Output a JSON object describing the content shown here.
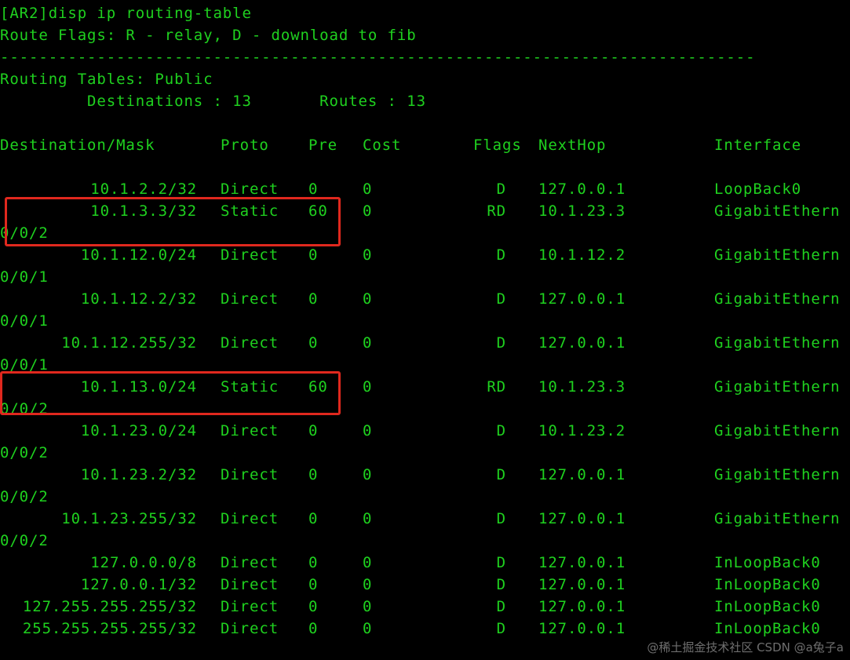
{
  "terminal": {
    "header_lines": [
      "[AR2]disp ip routing-table",
      "Route Flags: R - relay, D - download to fib",
      "------------------------------------------------------------------------------",
      "Routing Tables: Public",
      "         Destinations : 13       Routes : 13"
    ],
    "columns": {
      "destination": "Destination/Mask",
      "proto": "Proto",
      "pre": "Pre",
      "cost": "Cost",
      "flags": "Flags",
      "nexthop": "NextHop",
      "interface": "Interface"
    },
    "routes": [
      {
        "dest": "10.1.2.2/32",
        "proto": "Direct",
        "pre": "0",
        "cost": "0",
        "flags": "D",
        "nexthop": "127.0.0.1",
        "iface": "LoopBack0",
        "wrap": ""
      },
      {
        "dest": "10.1.3.3/32",
        "proto": "Static",
        "pre": "60",
        "cost": "0",
        "flags": "RD",
        "nexthop": "10.1.23.3",
        "iface": "GigabitEthern",
        "wrap": "0/0/2"
      },
      {
        "dest": "10.1.12.0/24",
        "proto": "Direct",
        "pre": "0",
        "cost": "0",
        "flags": "D",
        "nexthop": "10.1.12.2",
        "iface": "GigabitEthern",
        "wrap": "0/0/1"
      },
      {
        "dest": "10.1.12.2/32",
        "proto": "Direct",
        "pre": "0",
        "cost": "0",
        "flags": "D",
        "nexthop": "127.0.0.1",
        "iface": "GigabitEthern",
        "wrap": "0/0/1"
      },
      {
        "dest": "10.1.12.255/32",
        "proto": "Direct",
        "pre": "0",
        "cost": "0",
        "flags": "D",
        "nexthop": "127.0.0.1",
        "iface": "GigabitEthern",
        "wrap": "0/0/1"
      },
      {
        "dest": "10.1.13.0/24",
        "proto": "Static",
        "pre": "60",
        "cost": "0",
        "flags": "RD",
        "nexthop": "10.1.23.3",
        "iface": "GigabitEthern",
        "wrap": "0/0/2"
      },
      {
        "dest": "10.1.23.0/24",
        "proto": "Direct",
        "pre": "0",
        "cost": "0",
        "flags": "D",
        "nexthop": "10.1.23.2",
        "iface": "GigabitEthern",
        "wrap": "0/0/2"
      },
      {
        "dest": "10.1.23.2/32",
        "proto": "Direct",
        "pre": "0",
        "cost": "0",
        "flags": "D",
        "nexthop": "127.0.0.1",
        "iface": "GigabitEthern",
        "wrap": "0/0/2"
      },
      {
        "dest": "10.1.23.255/32",
        "proto": "Direct",
        "pre": "0",
        "cost": "0",
        "flags": "D",
        "nexthop": "127.0.0.1",
        "iface": "GigabitEthern",
        "wrap": "0/0/2"
      },
      {
        "dest": "127.0.0.0/8",
        "proto": "Direct",
        "pre": "0",
        "cost": "0",
        "flags": "D",
        "nexthop": "127.0.0.1",
        "iface": "InLoopBack0",
        "wrap": ""
      },
      {
        "dest": "127.0.0.1/32",
        "proto": "Direct",
        "pre": "0",
        "cost": "0",
        "flags": "D",
        "nexthop": "127.0.0.1",
        "iface": "InLoopBack0",
        "wrap": ""
      },
      {
        "dest": "127.255.255.255/32",
        "proto": "Direct",
        "pre": "0",
        "cost": "0",
        "flags": "D",
        "nexthop": "127.0.0.1",
        "iface": "InLoopBack0",
        "wrap": ""
      },
      {
        "dest": "255.255.255.255/32",
        "proto": "Direct",
        "pre": "0",
        "cost": "0",
        "flags": "D",
        "nexthop": "127.0.0.1",
        "iface": "InLoopBack0",
        "wrap": ""
      }
    ],
    "highlighted_routes": [
      1,
      5
    ]
  },
  "watermark": "@稀土掘金技术社区 CSDN @a兔子a",
  "colors": {
    "background": "#000000",
    "text": "#1fd11f",
    "highlight_box": "#e0281e"
  }
}
